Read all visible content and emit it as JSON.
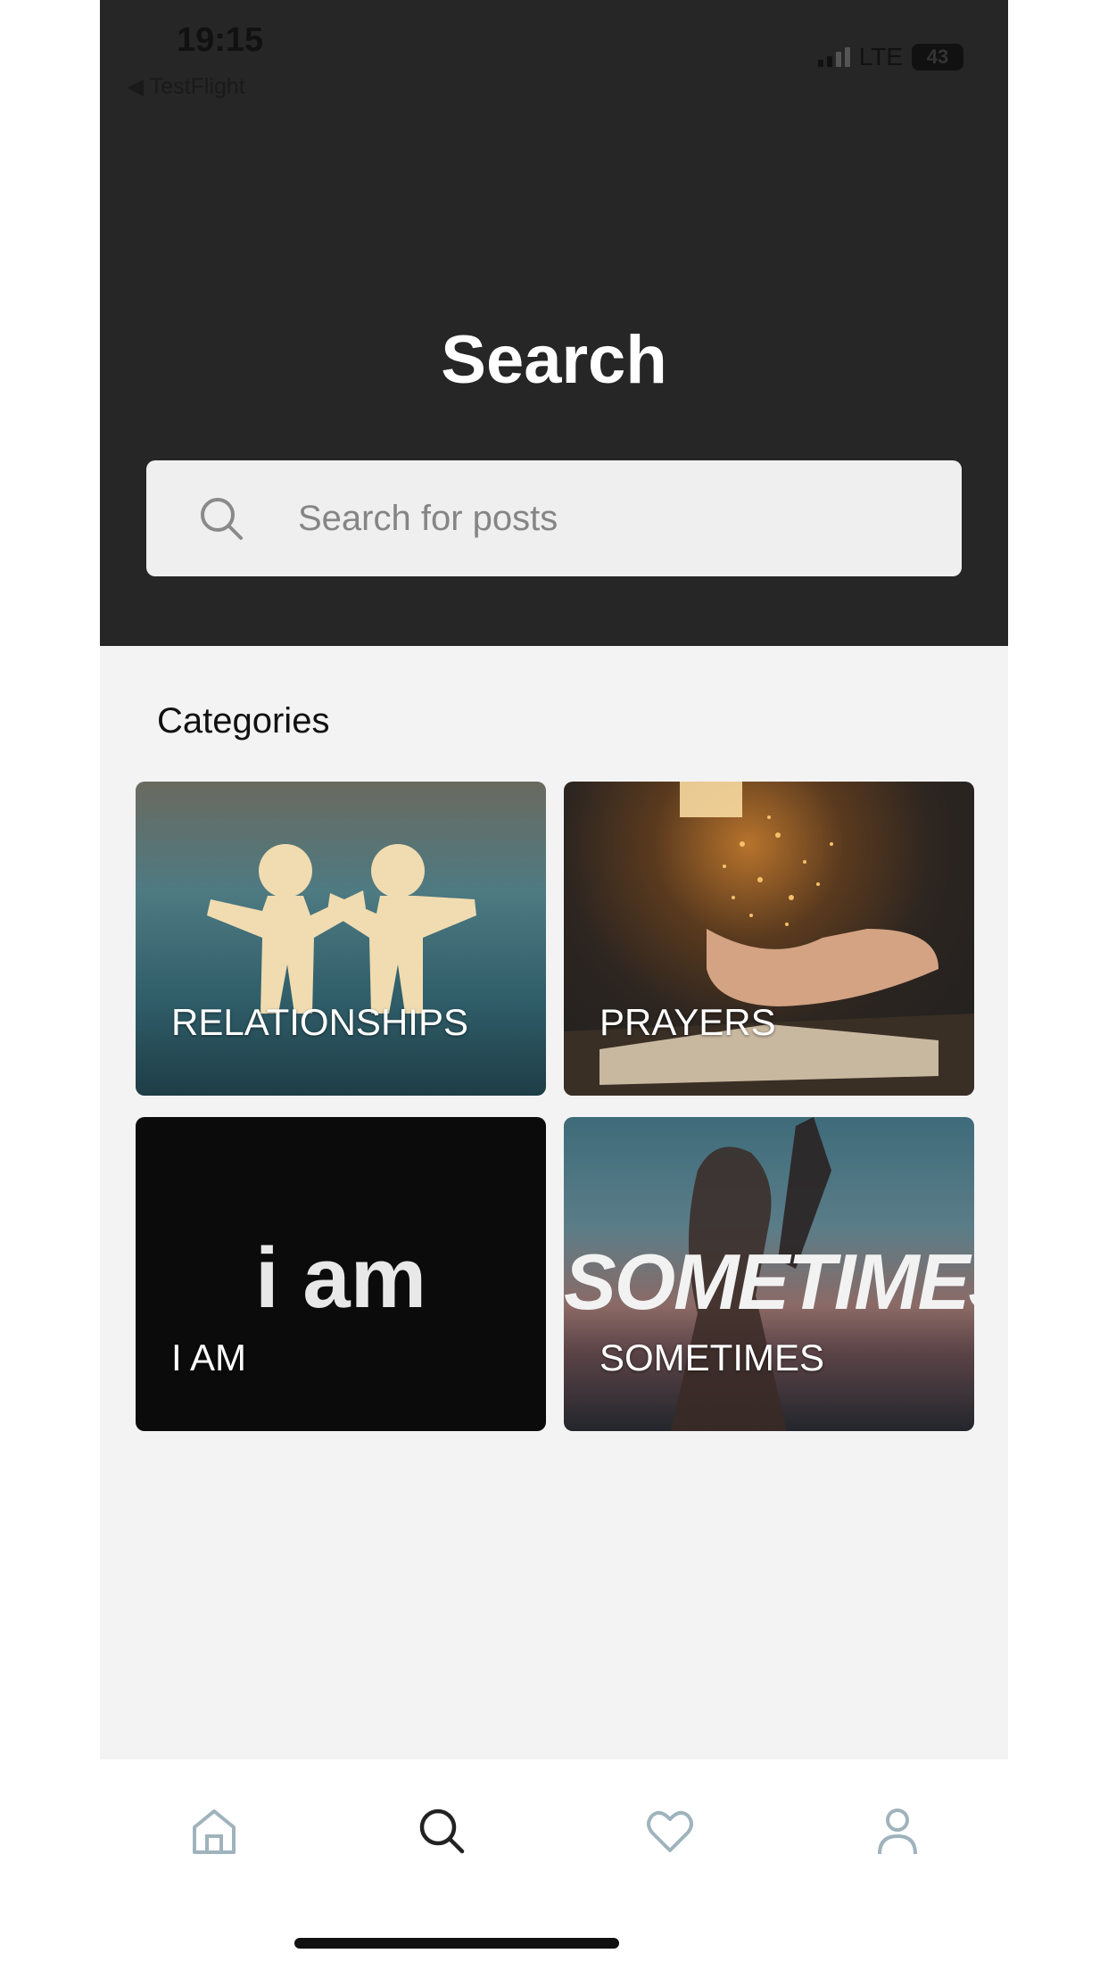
{
  "status_bar": {
    "time": "19:15",
    "back_app": "◀ TestFlight",
    "network": "LTE",
    "battery": "43"
  },
  "header": {
    "title": "Search"
  },
  "search": {
    "placeholder": "Search for posts"
  },
  "categories": {
    "title": "Categories",
    "items": [
      {
        "label": "RELATIONSHIPS"
      },
      {
        "label": "PRAYERS"
      },
      {
        "label": "I AM",
        "image_text": "i am"
      },
      {
        "label": "SOMETIMES",
        "image_text": "SOMETIMES"
      }
    ]
  },
  "tabbar": {
    "items": [
      "home-icon",
      "search-icon",
      "heart-icon",
      "profile-icon"
    ],
    "active": "search-icon"
  },
  "colors": {
    "header_bg": "#262626",
    "content_bg": "#f3f3f3",
    "tab_inactive": "#9fb3bd",
    "tab_active": "#222222"
  }
}
